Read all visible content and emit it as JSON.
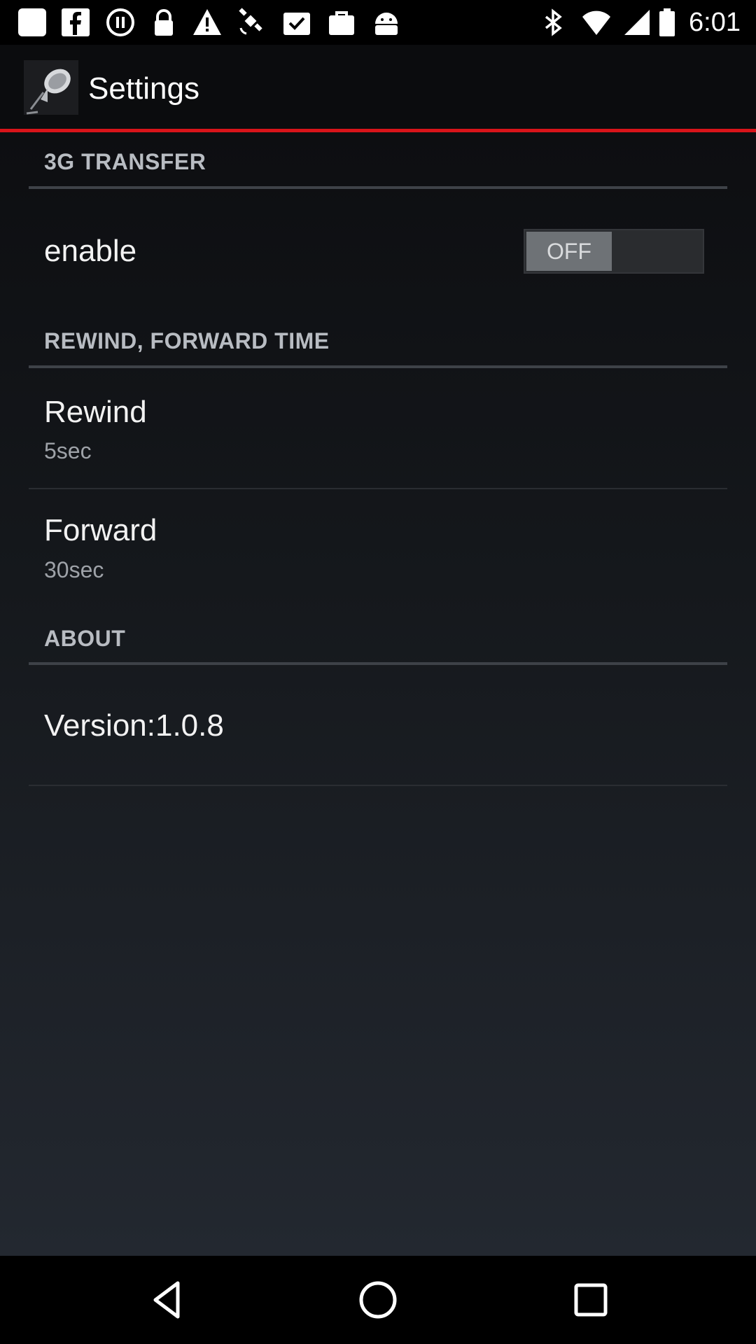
{
  "status_bar": {
    "time": "6:01",
    "left_icons": [
      "square-icon",
      "facebook-icon",
      "record-icon",
      "lock-icon",
      "warning-icon",
      "satellite-icon",
      "checkbox-icon",
      "bag-icon",
      "android-icon"
    ],
    "right_icons": [
      "bluetooth-icon",
      "wifi-icon",
      "signal-icon",
      "battery-icon"
    ]
  },
  "action_bar": {
    "title": "Settings",
    "app_icon": "microphone-icon",
    "accent_color": "#d8141a"
  },
  "sections": {
    "transfer": {
      "header": "3G TRANSFER",
      "enable_title": "enable",
      "enable_state": "OFF"
    },
    "time": {
      "header": "REWIND, FORWARD TIME",
      "rewind_title": "Rewind",
      "rewind_value": "5sec",
      "forward_title": "Forward",
      "forward_value": "30sec"
    },
    "about": {
      "header": "ABOUT",
      "version": "Version:1.0.8"
    }
  },
  "nav_bar": {
    "buttons": [
      "back-icon",
      "home-icon",
      "recents-icon"
    ]
  }
}
